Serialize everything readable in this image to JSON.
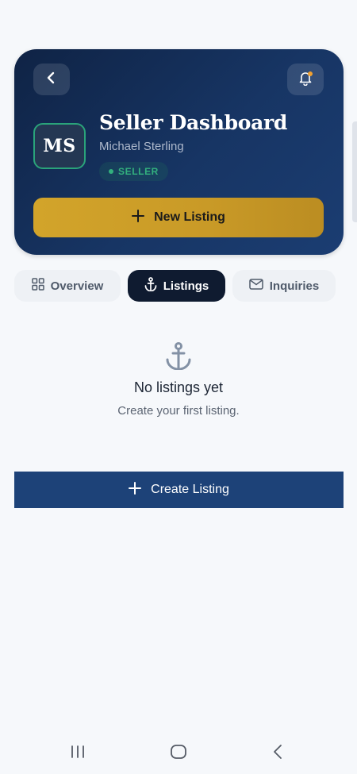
{
  "header": {
    "title": "Seller Dashboard",
    "user_name": "Michael Sterling",
    "avatar_initials": "MS",
    "role_badge": "SELLER",
    "new_listing_label": "New Listing"
  },
  "tabs": [
    {
      "label": "Overview",
      "icon": "grid-icon",
      "active": false
    },
    {
      "label": "Listings",
      "icon": "anchor-icon",
      "active": true
    },
    {
      "label": "Inquiries",
      "icon": "mail-icon",
      "active": false
    }
  ],
  "empty_state": {
    "title": "No listings yet",
    "subtitle": "Create your first listing.",
    "icon": "anchor-icon"
  },
  "create_button_label": "Create Listing",
  "colors": {
    "header_bg": "#173564",
    "accent_gold": "#d2a42a",
    "active_tab": "#0f1b30",
    "primary_button": "#1d4278",
    "badge_green": "#33b07e",
    "notification_dot": "#f0a030"
  }
}
